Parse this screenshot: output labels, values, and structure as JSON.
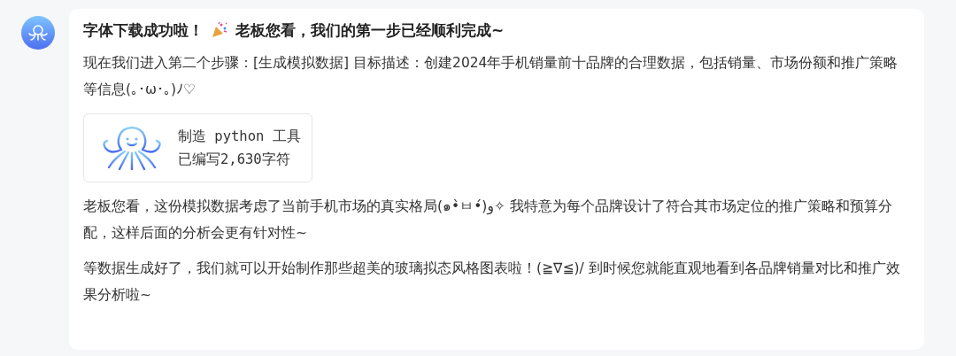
{
  "message": {
    "title_before": "字体下载成功啦！",
    "title_after": "老板您看，我们的第一步已经顺利完成~",
    "paragraphs_before": [
      "现在我们进入第二个步骤：[生成模拟数据] 目标描述：创建2024年手机销量前十品牌的合理数据，包括销量、市场份额和推广策略等信息(｡･ω･｡)ﾉ♡"
    ],
    "tool": {
      "name": "制造 python 工具",
      "detail": "已编写2,630字符"
    },
    "paragraphs_after": [
      "老板您看，这份模拟数据考虑了当前手机市场的真实格局(๑•̀ㅂ•́)و✧ 我特意为每个品牌设计了符合其市场定位的推广策略和预算分配，这样后面的分析会更有针对性~",
      "等数据生成好了，我们就可以开始制作那些超美的玻璃拟态风格图表啦！(≧∇≦)/ 到时候您就能直观地看到各品牌销量对比和推广效果分析啦~"
    ]
  }
}
